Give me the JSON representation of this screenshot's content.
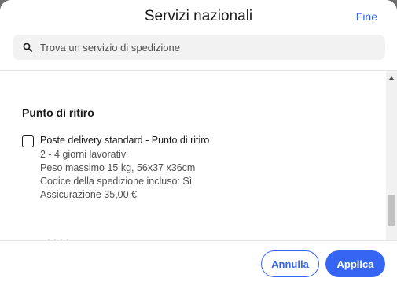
{
  "header": {
    "title": "Servizi nazionali",
    "done_label": "Fine"
  },
  "search": {
    "placeholder": "Trova un servizio di spedizione",
    "value": ""
  },
  "section": {
    "title": "Punto di ritiro",
    "option": {
      "name": "Poste delivery standard - Punto di ritiro",
      "checked": false,
      "lines": [
        "2 - 4 giorni lavorativi",
        "Peso massimo 15 kg, 56x37 x36cm",
        "Codice della spedizione incluso: Sì",
        "Assicurazione 35,00 €"
      ]
    }
  },
  "footer": {
    "cancel_label": "Annulla",
    "apply_label": "Applica"
  },
  "colors": {
    "accent": "#3665f3",
    "text": "#191919",
    "secondary_text": "#505050",
    "backdrop": "#6e6e6e"
  },
  "icons": {
    "search": "search-icon",
    "checkbox": "checkbox-unchecked-icon",
    "scroll_up": "scroll-up-arrow-icon"
  }
}
